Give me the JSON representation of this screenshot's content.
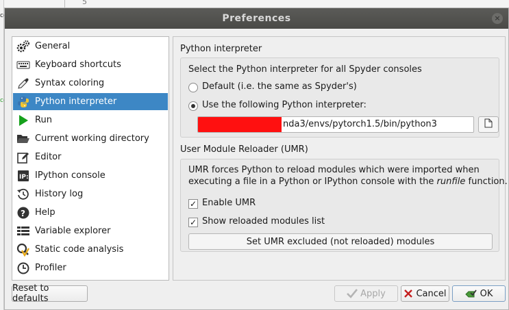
{
  "background": {
    "line_number": "5",
    "left_fragments": [
      "ce",
      "ce"
    ]
  },
  "window": {
    "title": "Preferences",
    "close_glyph": "×"
  },
  "sidebar": {
    "items": [
      {
        "label": "General",
        "icon": "gears-icon"
      },
      {
        "label": "Keyboard shortcuts",
        "icon": "keyboard-icon"
      },
      {
        "label": "Syntax coloring",
        "icon": "eyedropper-icon"
      },
      {
        "label": "Python interpreter",
        "icon": "python-logo-icon",
        "active": true
      },
      {
        "label": "Run",
        "icon": "play-icon"
      },
      {
        "label": "Current working directory",
        "icon": "folder-open-icon"
      },
      {
        "label": "Editor",
        "icon": "edit-icon"
      },
      {
        "label": "IPython console",
        "icon": "ipython-icon"
      },
      {
        "label": "History log",
        "icon": "history-icon"
      },
      {
        "label": "Help",
        "icon": "help-icon"
      },
      {
        "label": "Variable explorer",
        "icon": "table-list-icon"
      },
      {
        "label": "Static code analysis",
        "icon": "code-analysis-icon"
      },
      {
        "label": "Profiler",
        "icon": "clock-icon"
      }
    ]
  },
  "python_interpreter": {
    "section_title": "Python interpreter",
    "description": "Select the Python interpreter for all Spyder consoles",
    "option_default": "Default (i.e. the same as Spyder's)",
    "option_custom": "Use the following Python interpreter:",
    "path_value": "nda3/envs/pytorch1.5/bin/python3",
    "selected": "custom"
  },
  "umr": {
    "section_title": "User Module Reloader (UMR)",
    "description_line1": "UMR forces Python to reload modules which were imported when",
    "description_line2_pre": "executing a file in a Python or IPython console with the ",
    "description_line2_em": "runfile",
    "description_line2_post": " function.",
    "enable_label": "Enable UMR",
    "show_label": "Show reloaded modules list",
    "check_glyph": "✓",
    "enable_checked": true,
    "show_checked": true,
    "excluded_button": "Set UMR excluded (not reloaded) modules"
  },
  "buttons": {
    "reset": "Reset to defaults",
    "apply": "Apply",
    "cancel": "Cancel",
    "ok": "OK"
  },
  "colors": {
    "selection": "#3d87c5",
    "titlebar": "#4f4f4c",
    "redaction": "#ff1010"
  }
}
